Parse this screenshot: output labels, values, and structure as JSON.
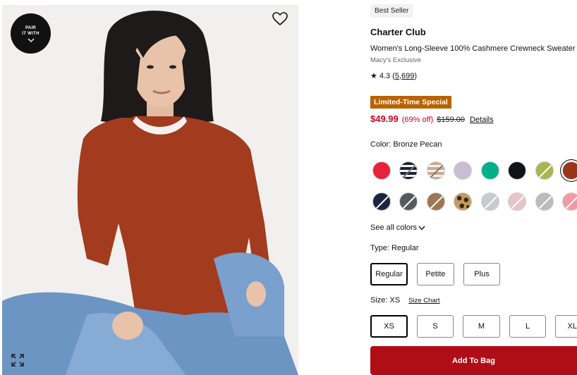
{
  "image": {
    "pair_badge": {
      "line1": "PAIR",
      "line2": "IT WITH",
      "icon": "chevron-down-icon"
    },
    "favorite_icon": "heart-icon",
    "expand_icon": "expand-icon"
  },
  "product": {
    "badge": "Best Seller",
    "brand": "Charter Club",
    "name": "Women's Long-Sleeve 100% Cashmere Crewneck Sweater",
    "exclusive": "Macy's Exclusive",
    "rating": {
      "star": "★",
      "score": "4.3",
      "open": "(",
      "count": "5,699",
      "close": ")"
    },
    "promo_label": "Limited-Time Special",
    "price": "$49.99",
    "discount": "(69% off)",
    "original_price": "$159.00",
    "details_link": "Details"
  },
  "color": {
    "label": "Color: Bronze Pecan",
    "see_all": "See all colors",
    "swatches": [
      {
        "name": "red",
        "color": "#e8223a"
      },
      {
        "name": "navy-white-stripe",
        "color": "#1c2234"
      },
      {
        "name": "tan-white-stripe",
        "color": "#c9a88f"
      },
      {
        "name": "lilac",
        "color": "#c9bdd3"
      },
      {
        "name": "jade",
        "color": "#00b08a"
      },
      {
        "name": "black",
        "color": "#111318"
      },
      {
        "name": "lime",
        "color": "#a8b64e"
      },
      {
        "name": "bronze-pecan",
        "color": "#9c3418",
        "selected": true
      },
      {
        "name": "navy",
        "color": "#1a2540"
      },
      {
        "name": "charcoal",
        "color": "#56595d"
      },
      {
        "name": "camel",
        "color": "#9d7656"
      },
      {
        "name": "leopard",
        "color": "#c49a62"
      },
      {
        "name": "light-grey",
        "color": "#c9cacc"
      },
      {
        "name": "blush",
        "color": "#e7c4cb"
      },
      {
        "name": "silver-grey",
        "color": "#bcbcbc"
      },
      {
        "name": "pink",
        "color": "#f19aa3"
      }
    ]
  },
  "type": {
    "label": "Type: Regular",
    "options": [
      "Regular",
      "Petite",
      "Plus"
    ]
  },
  "size": {
    "label": "Size: XS",
    "chart_link": "Size Chart",
    "options": [
      "XS",
      "S",
      "M",
      "L",
      "XL"
    ]
  },
  "cta": {
    "add_to_bag": "Add To Bag"
  }
}
